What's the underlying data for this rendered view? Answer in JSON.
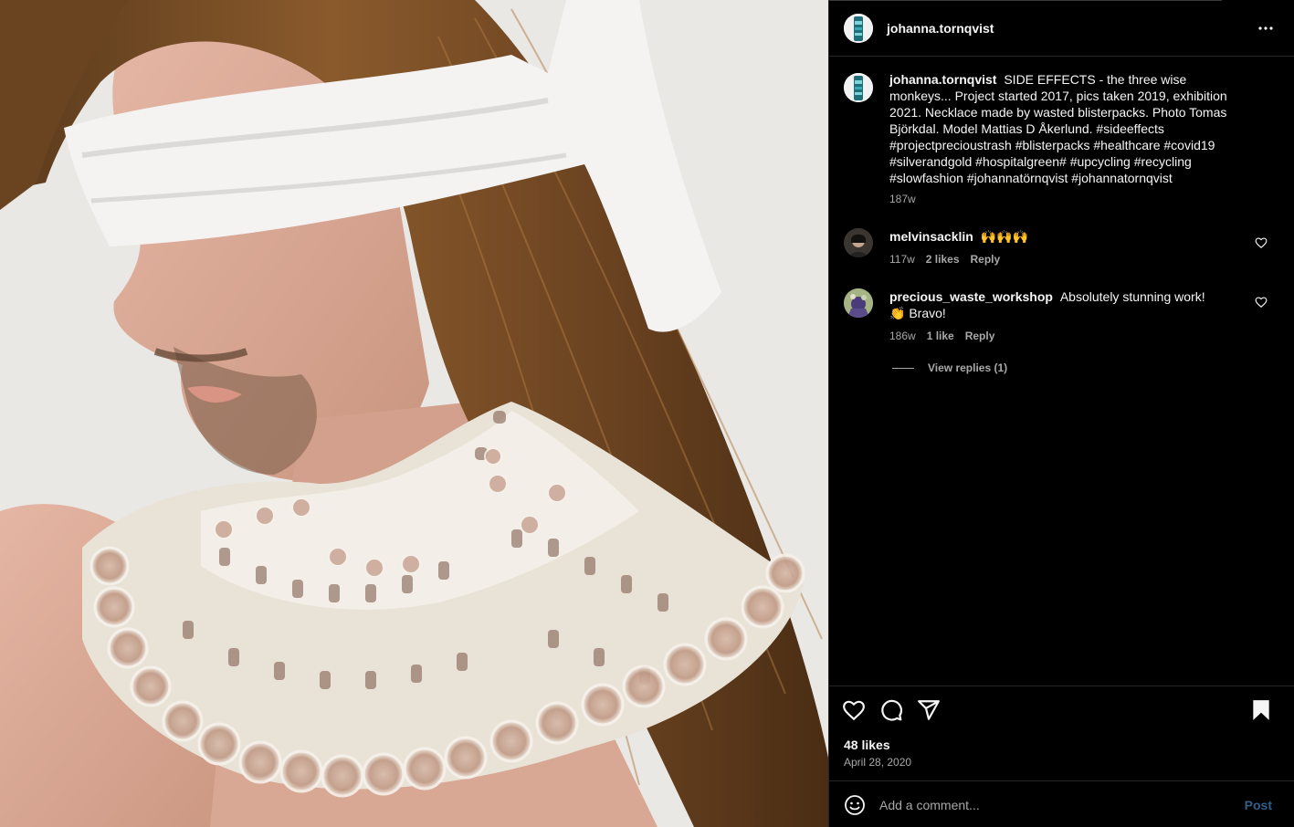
{
  "post": {
    "author": "johanna.tornqvist",
    "caption_author": "johanna.tornqvist",
    "caption_text": "SIDE EFFECTS - the three wise monkeys... Project started 2017, pics taken 2019, exhibition 2021. Necklace made by wasted blisterpacks. Photo Tomas Björkdal. Model Mattias D Åkerlund. #sideeffects #projectprecioustrash #blisterpacks #healthcare #covid19 #silverandgold #hospitalgreen# #upcycling #recycling #slowfashion #johannatörnqvist #johannatornqvist",
    "caption_age": "187w",
    "likes": "48 likes",
    "date": "April 28, 2020"
  },
  "comments": [
    {
      "username": "melvinsacklin",
      "text": "🙌🙌🙌",
      "age": "117w",
      "likes": "2 likes",
      "reply": "Reply"
    },
    {
      "username": "precious_waste_workshop",
      "text": "Absolutely stunning work! 👏 Bravo!",
      "age": "186w",
      "likes": "1 like",
      "reply": "Reply"
    }
  ],
  "view_replies": "View replies (1)",
  "comment_box": {
    "placeholder": "Add a comment...",
    "post_label": "Post"
  },
  "icons": {
    "more": "more-options-icon",
    "like": "heart-icon",
    "comment": "comment-icon",
    "share": "share-icon",
    "save": "bookmark-icon",
    "emoji": "emoji-icon"
  },
  "colors": {
    "background": "#000000",
    "text": "#f5f5f5",
    "muted": "#a8a8a8",
    "post_button": "#2f5f8a",
    "divider": "#262626"
  }
}
